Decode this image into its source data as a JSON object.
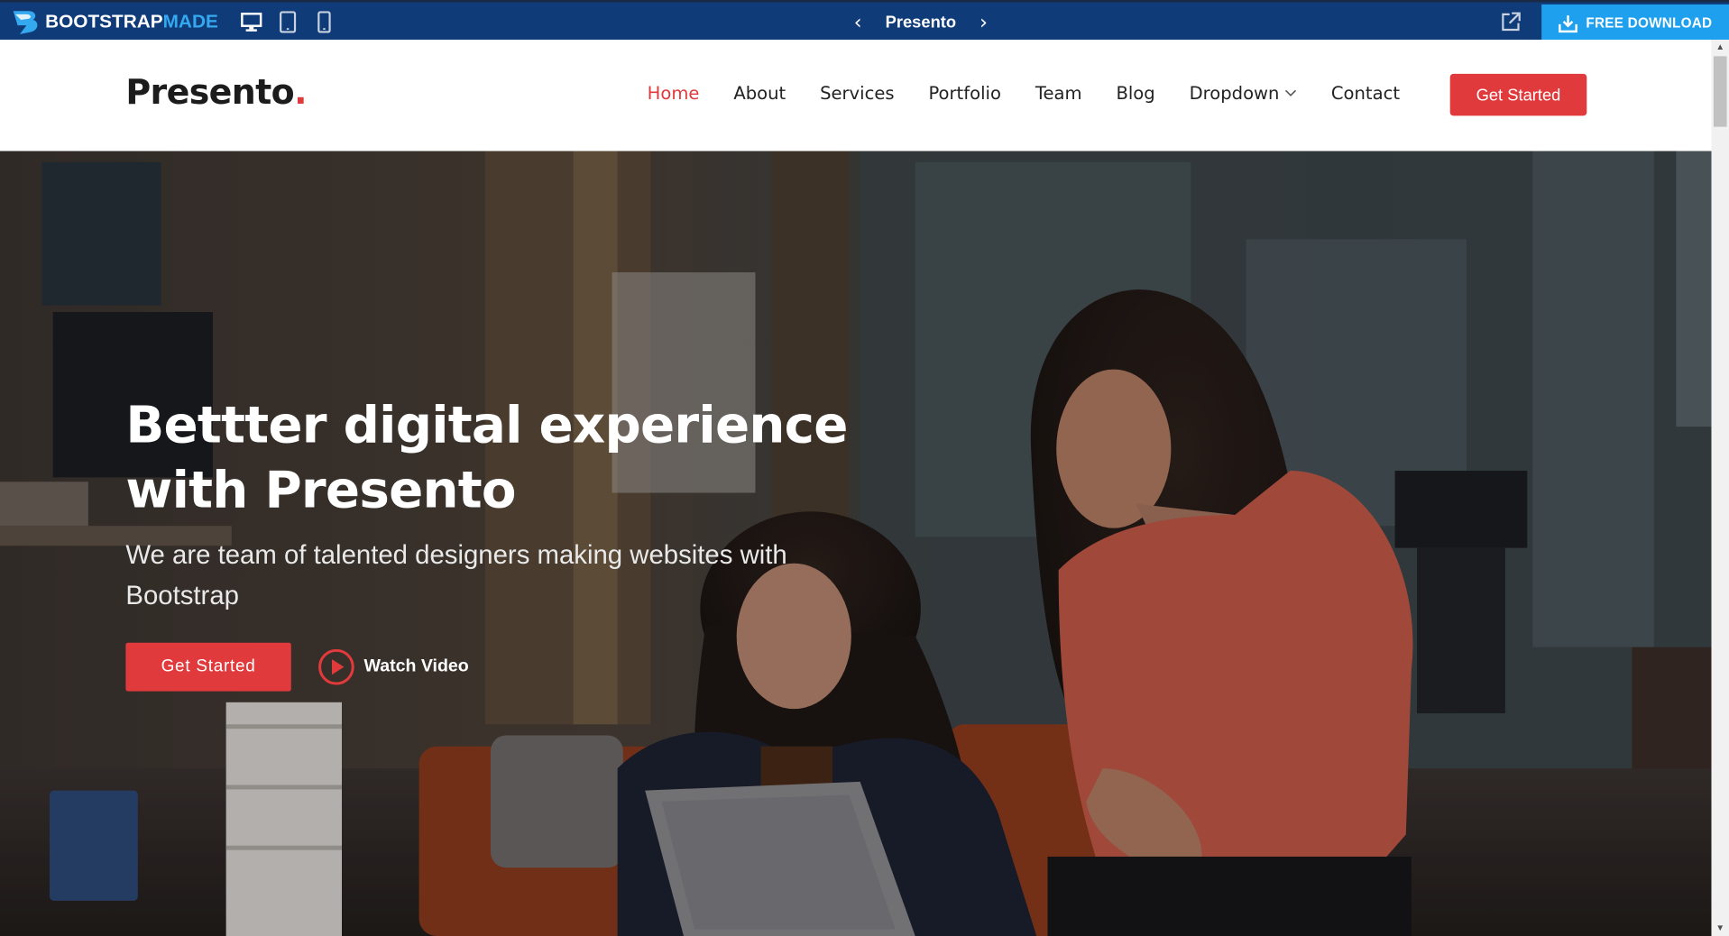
{
  "bootstrapmade_bar": {
    "logo_main": "BOOTSTRAP",
    "logo_accent": "MADE",
    "devices": [
      "desktop-icon",
      "tablet-icon",
      "phone-icon"
    ],
    "template_title": "Presento",
    "prev_arrow": "‹",
    "next_arrow": "›",
    "download_label": "FREE DOWNLOAD",
    "colors": {
      "bar_bg": "#0f3b78",
      "download_bg": "#1ea0ee",
      "logo_accent": "#35a9ef"
    }
  },
  "header": {
    "logo_text": "Presento",
    "logo_dot": ".",
    "nav": [
      {
        "label": "Home",
        "active": true
      },
      {
        "label": "About"
      },
      {
        "label": "Services"
      },
      {
        "label": "Portfolio"
      },
      {
        "label": "Team"
      },
      {
        "label": "Blog"
      },
      {
        "label": "Dropdown",
        "has_submenu": true
      },
      {
        "label": "Contact"
      }
    ],
    "cta_label": "Get Started",
    "colors": {
      "accent": "#e03a3c",
      "text": "#222222"
    }
  },
  "hero": {
    "title": "Bettter digital experience with Presento",
    "subtitle": "We are team of talented designers making websites with Bootstrap",
    "cta_label": "Get Started",
    "video_label": "Watch Video",
    "background": "photo of two women working on a laptop in an office, darkened overlay"
  }
}
